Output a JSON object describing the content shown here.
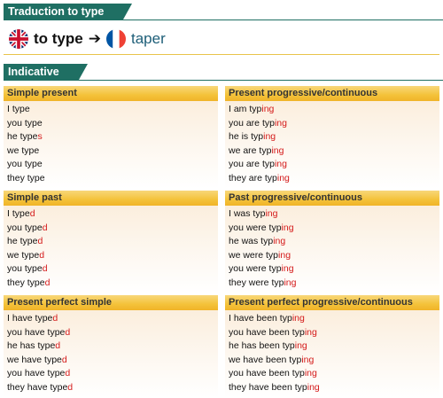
{
  "traduction": {
    "header": "Traduction to type",
    "en": "to type",
    "fr": "taper",
    "arrow": "➔"
  },
  "indicative": {
    "header": "Indicative"
  },
  "colors": {
    "accent": "#1f6f63",
    "ending": "#d41a1a",
    "panel_title": "#f4c23a"
  },
  "panels": [
    {
      "title": "Simple present",
      "lines": [
        {
          "stem": "I type",
          "end": ""
        },
        {
          "stem": "you type",
          "end": ""
        },
        {
          "stem": "he type",
          "end": "s"
        },
        {
          "stem": "we type",
          "end": ""
        },
        {
          "stem": "you type",
          "end": ""
        },
        {
          "stem": "they type",
          "end": ""
        }
      ]
    },
    {
      "title": "Present progressive/continuous",
      "lines": [
        {
          "stem": "I am typ",
          "end": "ing"
        },
        {
          "stem": "you are typ",
          "end": "ing"
        },
        {
          "stem": "he is typ",
          "end": "ing"
        },
        {
          "stem": "we are typ",
          "end": "ing"
        },
        {
          "stem": "you are typ",
          "end": "ing"
        },
        {
          "stem": "they are typ",
          "end": "ing"
        }
      ]
    },
    {
      "title": "Simple past",
      "lines": [
        {
          "stem": "I type",
          "end": "d"
        },
        {
          "stem": "you type",
          "end": "d"
        },
        {
          "stem": "he type",
          "end": "d"
        },
        {
          "stem": "we type",
          "end": "d"
        },
        {
          "stem": "you type",
          "end": "d"
        },
        {
          "stem": "they type",
          "end": "d"
        }
      ]
    },
    {
      "title": "Past progressive/continuous",
      "lines": [
        {
          "stem": "I was typ",
          "end": "ing"
        },
        {
          "stem": "you were typ",
          "end": "ing"
        },
        {
          "stem": "he was typ",
          "end": "ing"
        },
        {
          "stem": "we were typ",
          "end": "ing"
        },
        {
          "stem": "you were typ",
          "end": "ing"
        },
        {
          "stem": "they were typ",
          "end": "ing"
        }
      ]
    },
    {
      "title": "Present perfect simple",
      "lines": [
        {
          "stem": "I have type",
          "end": "d"
        },
        {
          "stem": "you have type",
          "end": "d"
        },
        {
          "stem": "he has type",
          "end": "d"
        },
        {
          "stem": "we have type",
          "end": "d"
        },
        {
          "stem": "you have type",
          "end": "d"
        },
        {
          "stem": "they have type",
          "end": "d"
        }
      ]
    },
    {
      "title": "Present perfect progressive/continuous",
      "lines": [
        {
          "stem": "I have been typ",
          "end": "ing"
        },
        {
          "stem": "you have been typ",
          "end": "ing"
        },
        {
          "stem": "he has been typ",
          "end": "ing"
        },
        {
          "stem": "we have been typ",
          "end": "ing"
        },
        {
          "stem": "you have been typ",
          "end": "ing"
        },
        {
          "stem": "they have been typ",
          "end": "ing"
        }
      ]
    }
  ]
}
